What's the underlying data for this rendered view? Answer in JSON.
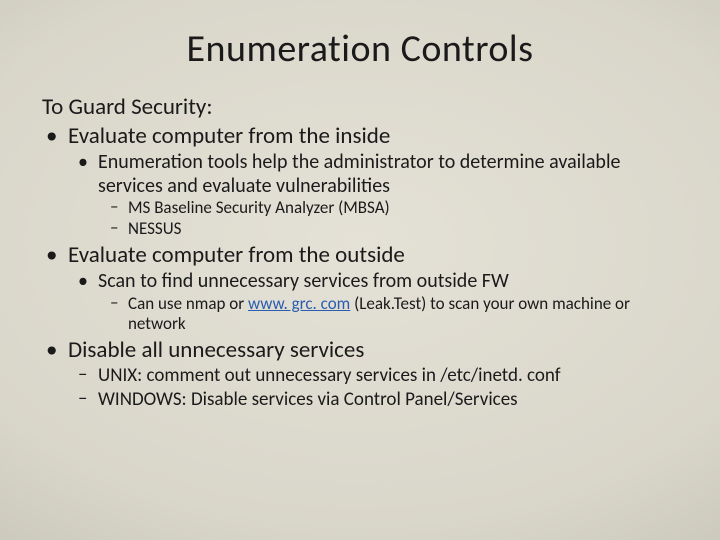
{
  "title": "Enumeration Controls",
  "lead": "To Guard Security:",
  "items": [
    {
      "text": "Evaluate computer from the inside",
      "sub": [
        {
          "text": "Enumeration tools help the administrator to determine available services and evaluate vulnerabilities",
          "sub": [
            {
              "text": "MS Baseline Security Analyzer (MBSA)"
            },
            {
              "text": "NESSUS"
            }
          ]
        }
      ]
    },
    {
      "text": "Evaluate computer from the outside",
      "sub": [
        {
          "text": "Scan to find unnecessary services from outside FW",
          "sub": [
            {
              "pre": "Can use nmap or ",
              "link_text": "www. grc. com",
              "link_href": "http://www.grc.com",
              "post": "  (Leak.Test) to scan your own machine or network"
            }
          ]
        }
      ]
    },
    {
      "text": "Disable all unnecessary services",
      "dash_sub": [
        {
          "text": "UNIX: comment out unnecessary services in /etc/inetd. conf"
        },
        {
          "text": "WINDOWS: Disable services via Control Panel/Services"
        }
      ]
    }
  ]
}
